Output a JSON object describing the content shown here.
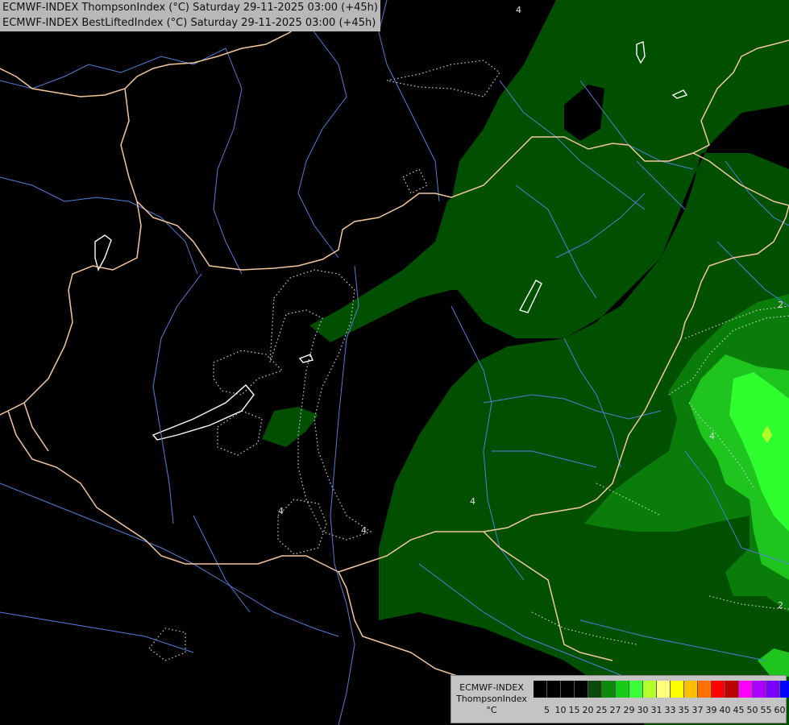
{
  "header": {
    "line1": "ECMWF-INDEX ThompsonIndex (°C) Saturday 29-11-2025 03:00 (+45h)",
    "line2": "ECMWF-INDEX BestLiftedIndex (°C) Saturday 29-11-2025 03:00 (+45h)"
  },
  "legend": {
    "line1": "ECMWF-INDEX",
    "line2": "ThompsonIndex",
    "line3": "°C",
    "colors": [
      "#000000",
      "#000000",
      "#000000",
      "#000000",
      "#0b4a0b",
      "#0c8a0c",
      "#17cc17",
      "#37ff37",
      "#b2ff2a",
      "#ffff7d",
      "#ffff00",
      "#ffbe00",
      "#ff7000",
      "#ff0000",
      "#bb0000",
      "#ff00ff",
      "#aa00ff",
      "#7700ff",
      "#0000ff"
    ],
    "ticks": [
      "5",
      "10",
      "15",
      "20",
      "25",
      "27",
      "29",
      "30",
      "31",
      "33",
      "35",
      "37",
      "39",
      "40",
      "45",
      "50",
      "55",
      "60"
    ]
  },
  "contour_labels": [
    "4",
    "2",
    "4",
    "2",
    "4",
    "4",
    "4"
  ],
  "palette": {
    "green_dark": "#005000",
    "green_mid": "#0a7c0a",
    "green_light": "#1fc41f",
    "green_bright": "#2fff2f",
    "border": "#f2c79b",
    "river": "#4f7fd8"
  }
}
